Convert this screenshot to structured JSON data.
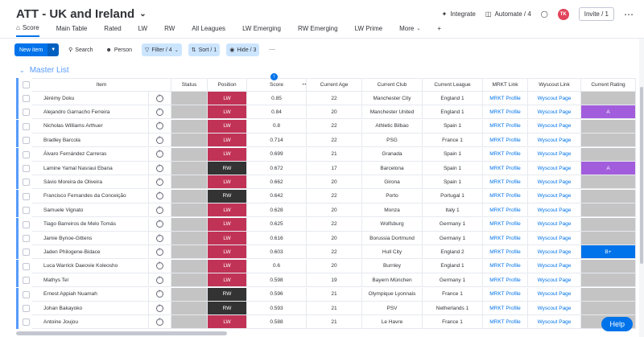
{
  "header": {
    "title": "ATT - UK and Ireland",
    "integrate": "Integrate",
    "automate": "Automate / 4",
    "avatar": "TK",
    "invite": "Invite / 1"
  },
  "tabs": [
    {
      "label": "Score",
      "active": true
    },
    {
      "label": "Main Table"
    },
    {
      "label": "Rated"
    },
    {
      "label": "LW"
    },
    {
      "label": "RW"
    },
    {
      "label": "All Leagues"
    },
    {
      "label": "LW Emerging"
    },
    {
      "label": "RW Emerging"
    },
    {
      "label": "LW Prime"
    },
    {
      "label": "More"
    }
  ],
  "toolbar": {
    "new_item": "New item",
    "search": "Search",
    "person": "Person",
    "filter": "Filter / 4",
    "sort": "Sort / 1",
    "hide": "Hide / 3"
  },
  "group": {
    "title": "Master List"
  },
  "columns": [
    "Item",
    "Status",
    "Position",
    "Score",
    "Current Age",
    "Current Club",
    "Current League",
    "MRKT Link",
    "Wyscout Link",
    "Current Rating"
  ],
  "rows": [
    {
      "item": "Jérémy Doku",
      "position": "LW",
      "score": "0.85",
      "age": "22",
      "club": "Manchester City",
      "league": "England 1",
      "mrkt": "MRKT Profile",
      "wyscout": "Wyscout Page",
      "rating": ""
    },
    {
      "item": "Alejandro Garnacho Ferreira",
      "position": "LW",
      "score": "0.84",
      "age": "20",
      "club": "Manchester United",
      "league": "England 1",
      "mrkt": "MRKT Profile",
      "wyscout": "Wyscout Page",
      "rating": "A"
    },
    {
      "item": "Nicholas Williams Arthuer",
      "position": "LW",
      "score": "0.8",
      "age": "22",
      "club": "Athletic Bilbao",
      "league": "Spain 1",
      "mrkt": "MRKT Profile",
      "wyscout": "Wyscout Page",
      "rating": ""
    },
    {
      "item": "Bradley Barcola",
      "position": "LW",
      "score": "0.714",
      "age": "22",
      "club": "PSG",
      "league": "France 1",
      "mrkt": "MRKT Profile",
      "wyscout": "Wyscout Page",
      "rating": ""
    },
    {
      "item": "Álvaro Fernández Carreras",
      "position": "LW",
      "score": "0.699",
      "age": "21",
      "club": "Granada",
      "league": "Spain 1",
      "mrkt": "MRKT Profile",
      "wyscout": "Wyscout Page",
      "rating": ""
    },
    {
      "item": "Lamine Yamal Nasraui Ebana",
      "position": "RW",
      "score": "0.672",
      "age": "17",
      "club": "Barcelona",
      "league": "Spain 1",
      "mrkt": "MRKT Profile",
      "wyscout": "Wyscout Page",
      "rating": "A"
    },
    {
      "item": "Sávio Moreira de Oliveira",
      "position": "LW",
      "score": "0.662",
      "age": "20",
      "club": "Girona",
      "league": "Spain 1",
      "mrkt": "MRKT Profile",
      "wyscout": "Wyscout Page",
      "rating": ""
    },
    {
      "item": "Francisco Fernandes da Conceição",
      "position": "RW",
      "score": "0.642",
      "age": "22",
      "club": "Porto",
      "league": "Portugal 1",
      "mrkt": "MRKT Profile",
      "wyscout": "Wyscout Page",
      "rating": ""
    },
    {
      "item": "Samuele Vignato",
      "position": "LW",
      "score": "0.628",
      "age": "20",
      "club": "Monza",
      "league": "Italy 1",
      "mrkt": "MRKT Profile",
      "wyscout": "Wyscout Page",
      "rating": ""
    },
    {
      "item": "Tiago Barreiros de Melo Tomás",
      "position": "LW",
      "score": "0.625",
      "age": "22",
      "club": "Wolfsburg",
      "league": "Germany 1",
      "mrkt": "MRKT Profile",
      "wyscout": "Wyscout Page",
      "rating": ""
    },
    {
      "item": "Jamie Bynoe-Gittens",
      "position": "LW",
      "score": "0.616",
      "age": "20",
      "club": "Borussia Dortmund",
      "league": "Germany 1",
      "mrkt": "MRKT Profile",
      "wyscout": "Wyscout Page",
      "rating": ""
    },
    {
      "item": "Jaden Philogene-Bidace",
      "position": "LW",
      "score": "0.603",
      "age": "22",
      "club": "Hull City",
      "league": "England 2",
      "mrkt": "MRKT Profile",
      "wyscout": "Wyscout Page",
      "rating": "B+"
    },
    {
      "item": "Luca Warrick Daeovie Koleosho",
      "position": "LW",
      "score": "0.6",
      "age": "20",
      "club": "Burnley",
      "league": "England 1",
      "mrkt": "MRKT Profile",
      "wyscout": "Wyscout Page",
      "rating": ""
    },
    {
      "item": "Mathys Tel",
      "position": "LW",
      "score": "0.598",
      "age": "19",
      "club": "Bayern München",
      "league": "Germany 1",
      "mrkt": "MRKT Profile",
      "wyscout": "Wyscout Page",
      "rating": ""
    },
    {
      "item": "Ernest Appiah Nuamah",
      "position": "RW",
      "score": "0.596",
      "age": "21",
      "club": "Olympique Lyonnais",
      "league": "France 1",
      "mrkt": "MRKT Profile",
      "wyscout": "Wyscout Page",
      "rating": ""
    },
    {
      "item": "Johan Bakayoko",
      "position": "RW",
      "score": "0.593",
      "age": "21",
      "club": "PSV",
      "league": "Netherlands 1",
      "mrkt": "MRKT Profile",
      "wyscout": "Wyscout Page",
      "rating": ""
    },
    {
      "item": "Antoine Joujou",
      "position": "LW",
      "score": "0.588",
      "age": "21",
      "club": "Le Havre",
      "league": "France 1",
      "mrkt": "MRKT Profile",
      "wyscout": "Wyscout Page",
      "rating": ""
    }
  ],
  "sort_badge": "↑",
  "help": "Help"
}
